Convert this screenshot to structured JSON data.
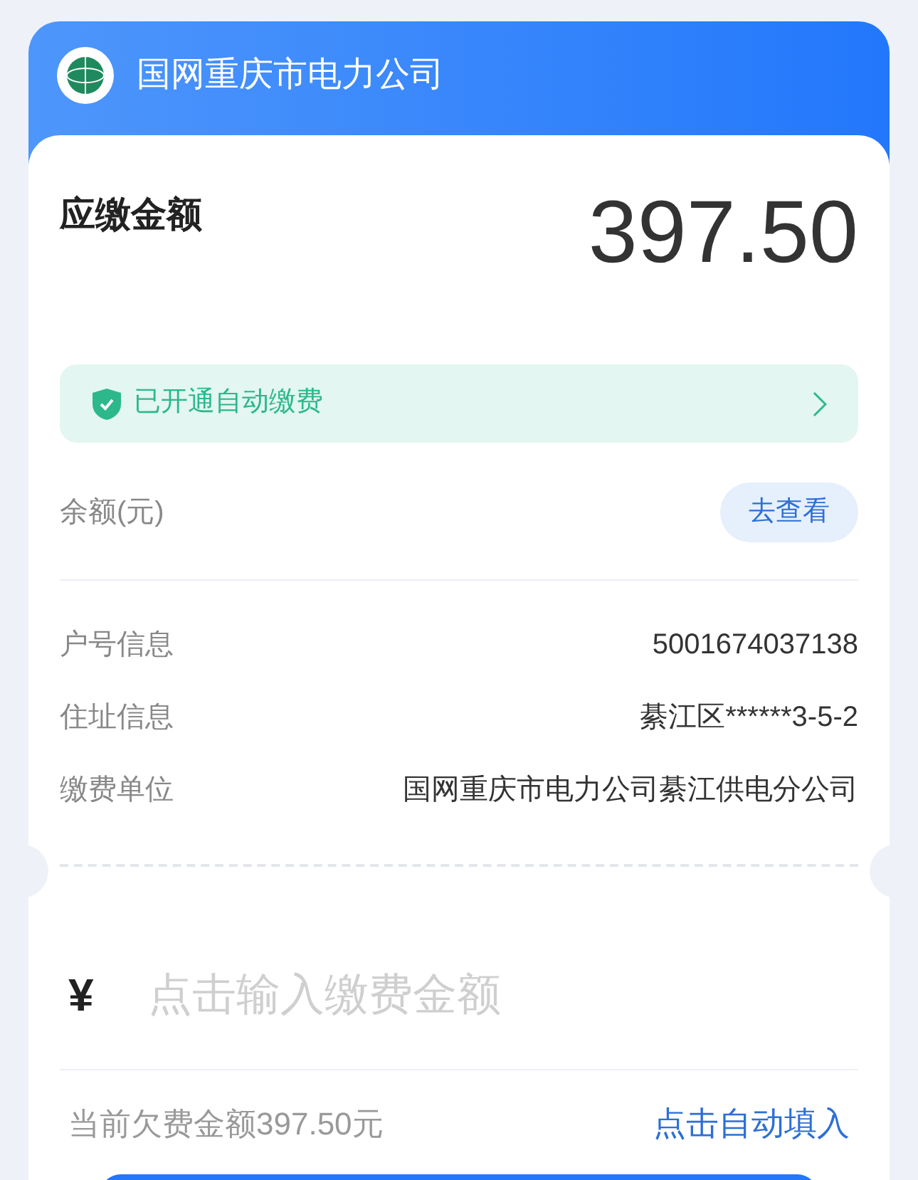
{
  "header": {
    "title": "国网重庆市电力公司"
  },
  "amount_due": {
    "label": "应缴金额",
    "value": "397.50"
  },
  "auto_pay": {
    "label": "已开通自动缴费",
    "enabled": true
  },
  "balance": {
    "label": "余额(元)",
    "button": "去查看"
  },
  "info": [
    {
      "label": "户号信息",
      "value": "5001674037138"
    },
    {
      "label": "住址信息",
      "value": "綦江区******3-5-2"
    },
    {
      "label": "缴费单位",
      "value": "国网重庆市电力公司綦江供电分公司"
    }
  ],
  "payment": {
    "currency": "¥",
    "placeholder": "点击输入缴费金额",
    "owed_note": "当前欠费金额397.50元",
    "autofill_link": "点击自动填入"
  }
}
